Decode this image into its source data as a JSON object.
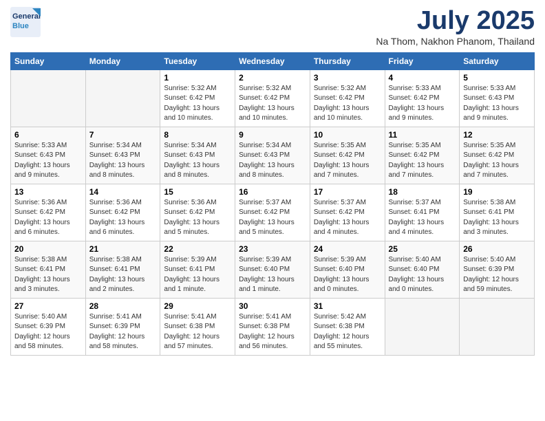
{
  "header": {
    "logo_line1": "General",
    "logo_line2": "Blue",
    "month": "July 2025",
    "location": "Na Thom, Nakhon Phanom, Thailand"
  },
  "days_of_week": [
    "Sunday",
    "Monday",
    "Tuesday",
    "Wednesday",
    "Thursday",
    "Friday",
    "Saturday"
  ],
  "weeks": [
    [
      {
        "day": "",
        "info": ""
      },
      {
        "day": "",
        "info": ""
      },
      {
        "day": "1",
        "info": "Sunrise: 5:32 AM\nSunset: 6:42 PM\nDaylight: 13 hours\nand 10 minutes."
      },
      {
        "day": "2",
        "info": "Sunrise: 5:32 AM\nSunset: 6:42 PM\nDaylight: 13 hours\nand 10 minutes."
      },
      {
        "day": "3",
        "info": "Sunrise: 5:32 AM\nSunset: 6:42 PM\nDaylight: 13 hours\nand 10 minutes."
      },
      {
        "day": "4",
        "info": "Sunrise: 5:33 AM\nSunset: 6:42 PM\nDaylight: 13 hours\nand 9 minutes."
      },
      {
        "day": "5",
        "info": "Sunrise: 5:33 AM\nSunset: 6:43 PM\nDaylight: 13 hours\nand 9 minutes."
      }
    ],
    [
      {
        "day": "6",
        "info": "Sunrise: 5:33 AM\nSunset: 6:43 PM\nDaylight: 13 hours\nand 9 minutes."
      },
      {
        "day": "7",
        "info": "Sunrise: 5:34 AM\nSunset: 6:43 PM\nDaylight: 13 hours\nand 8 minutes."
      },
      {
        "day": "8",
        "info": "Sunrise: 5:34 AM\nSunset: 6:43 PM\nDaylight: 13 hours\nand 8 minutes."
      },
      {
        "day": "9",
        "info": "Sunrise: 5:34 AM\nSunset: 6:43 PM\nDaylight: 13 hours\nand 8 minutes."
      },
      {
        "day": "10",
        "info": "Sunrise: 5:35 AM\nSunset: 6:42 PM\nDaylight: 13 hours\nand 7 minutes."
      },
      {
        "day": "11",
        "info": "Sunrise: 5:35 AM\nSunset: 6:42 PM\nDaylight: 13 hours\nand 7 minutes."
      },
      {
        "day": "12",
        "info": "Sunrise: 5:35 AM\nSunset: 6:42 PM\nDaylight: 13 hours\nand 7 minutes."
      }
    ],
    [
      {
        "day": "13",
        "info": "Sunrise: 5:36 AM\nSunset: 6:42 PM\nDaylight: 13 hours\nand 6 minutes."
      },
      {
        "day": "14",
        "info": "Sunrise: 5:36 AM\nSunset: 6:42 PM\nDaylight: 13 hours\nand 6 minutes."
      },
      {
        "day": "15",
        "info": "Sunrise: 5:36 AM\nSunset: 6:42 PM\nDaylight: 13 hours\nand 5 minutes."
      },
      {
        "day": "16",
        "info": "Sunrise: 5:37 AM\nSunset: 6:42 PM\nDaylight: 13 hours\nand 5 minutes."
      },
      {
        "day": "17",
        "info": "Sunrise: 5:37 AM\nSunset: 6:42 PM\nDaylight: 13 hours\nand 4 minutes."
      },
      {
        "day": "18",
        "info": "Sunrise: 5:37 AM\nSunset: 6:41 PM\nDaylight: 13 hours\nand 4 minutes."
      },
      {
        "day": "19",
        "info": "Sunrise: 5:38 AM\nSunset: 6:41 PM\nDaylight: 13 hours\nand 3 minutes."
      }
    ],
    [
      {
        "day": "20",
        "info": "Sunrise: 5:38 AM\nSunset: 6:41 PM\nDaylight: 13 hours\nand 3 minutes."
      },
      {
        "day": "21",
        "info": "Sunrise: 5:38 AM\nSunset: 6:41 PM\nDaylight: 13 hours\nand 2 minutes."
      },
      {
        "day": "22",
        "info": "Sunrise: 5:39 AM\nSunset: 6:41 PM\nDaylight: 13 hours\nand 1 minute."
      },
      {
        "day": "23",
        "info": "Sunrise: 5:39 AM\nSunset: 6:40 PM\nDaylight: 13 hours\nand 1 minute."
      },
      {
        "day": "24",
        "info": "Sunrise: 5:39 AM\nSunset: 6:40 PM\nDaylight: 13 hours\nand 0 minutes."
      },
      {
        "day": "25",
        "info": "Sunrise: 5:40 AM\nSunset: 6:40 PM\nDaylight: 13 hours\nand 0 minutes."
      },
      {
        "day": "26",
        "info": "Sunrise: 5:40 AM\nSunset: 6:39 PM\nDaylight: 12 hours\nand 59 minutes."
      }
    ],
    [
      {
        "day": "27",
        "info": "Sunrise: 5:40 AM\nSunset: 6:39 PM\nDaylight: 12 hours\nand 58 minutes."
      },
      {
        "day": "28",
        "info": "Sunrise: 5:41 AM\nSunset: 6:39 PM\nDaylight: 12 hours\nand 58 minutes."
      },
      {
        "day": "29",
        "info": "Sunrise: 5:41 AM\nSunset: 6:38 PM\nDaylight: 12 hours\nand 57 minutes."
      },
      {
        "day": "30",
        "info": "Sunrise: 5:41 AM\nSunset: 6:38 PM\nDaylight: 12 hours\nand 56 minutes."
      },
      {
        "day": "31",
        "info": "Sunrise: 5:42 AM\nSunset: 6:38 PM\nDaylight: 12 hours\nand 55 minutes."
      },
      {
        "day": "",
        "info": ""
      },
      {
        "day": "",
        "info": ""
      }
    ]
  ]
}
